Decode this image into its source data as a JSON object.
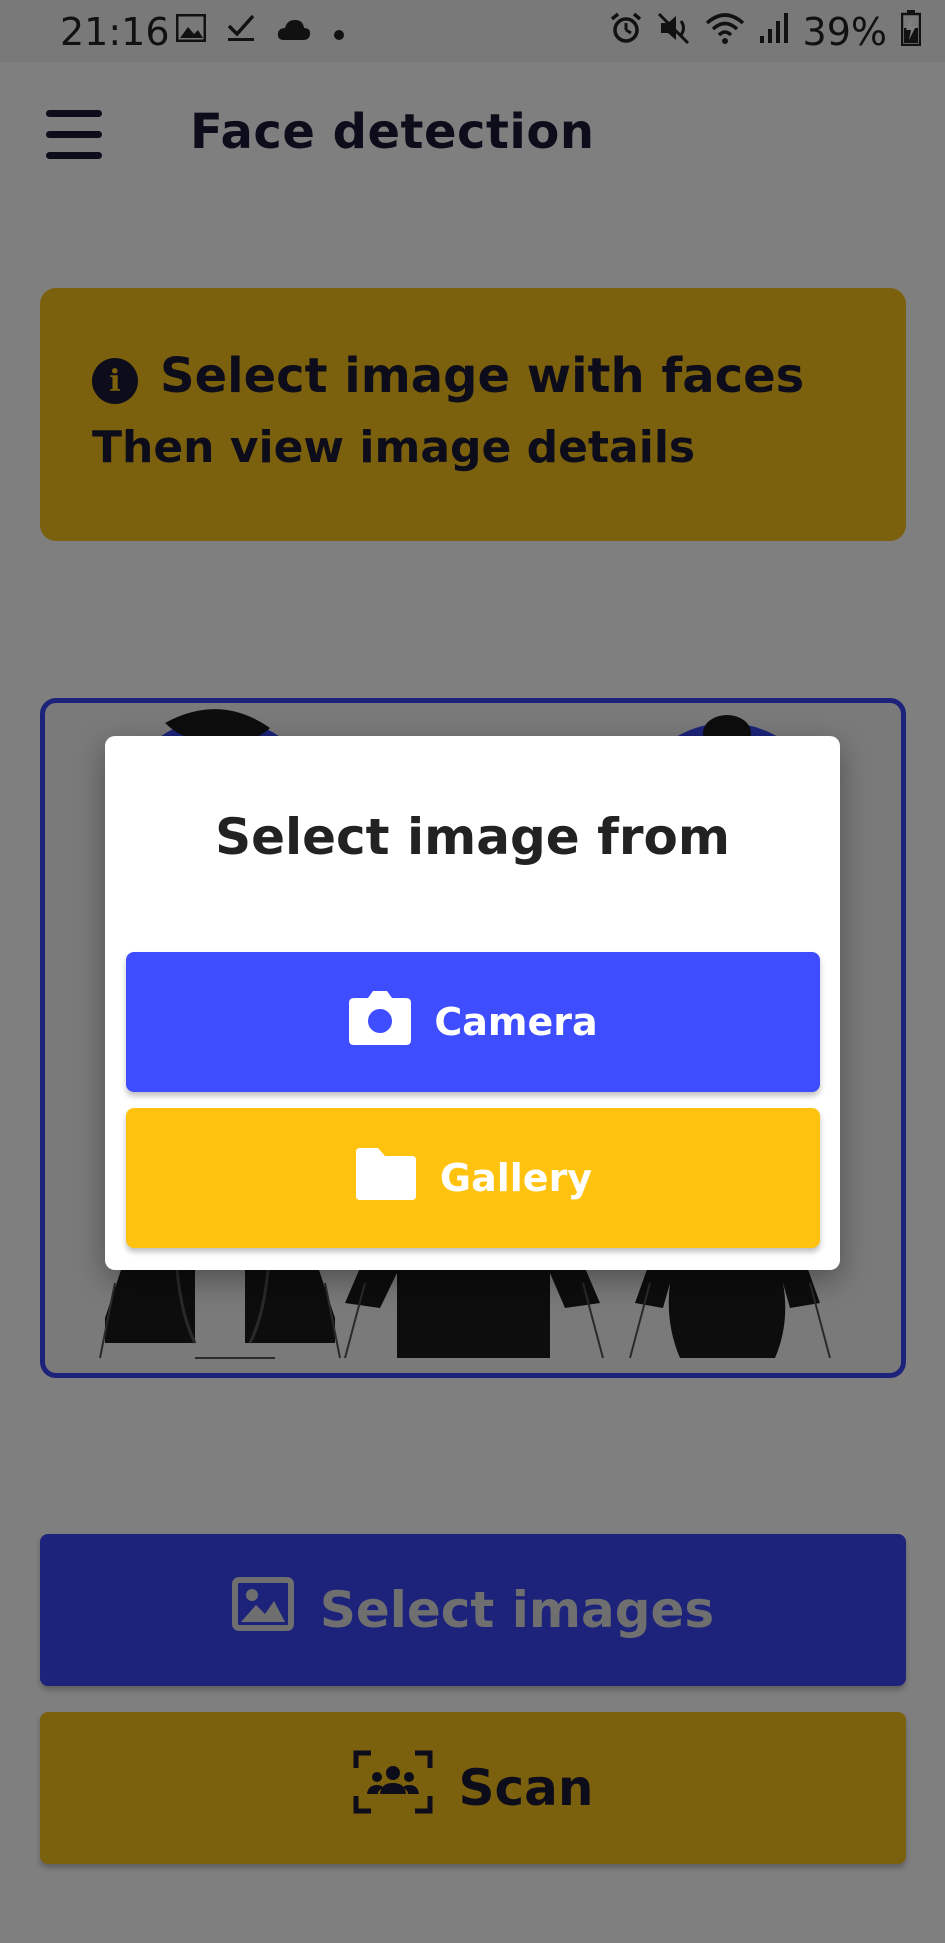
{
  "status_bar": {
    "time": "21:16",
    "battery": "39%",
    "left_icons": [
      "image-icon",
      "check-icon",
      "cloud-icon",
      "dot-icon"
    ],
    "right_icons": [
      "alarm-icon",
      "mute-icon",
      "wifi-icon",
      "signal-icon",
      "battery-charging-icon"
    ]
  },
  "app_bar": {
    "title": "Face detection",
    "menu_icon": "hamburger-menu-icon"
  },
  "info_card": {
    "icon": "info-icon",
    "icon_glyph": "i",
    "title": "Select image with faces",
    "subtitle": "Then view image details"
  },
  "dialog": {
    "title": "Select image from",
    "camera_label": "Camera",
    "gallery_label": "Gallery"
  },
  "actions": {
    "select_images_label": "Select images",
    "scan_label": "Scan"
  },
  "colors": {
    "blue": "#3d4dff",
    "yellow": "#ffc20e",
    "dark": "#1a1834"
  }
}
